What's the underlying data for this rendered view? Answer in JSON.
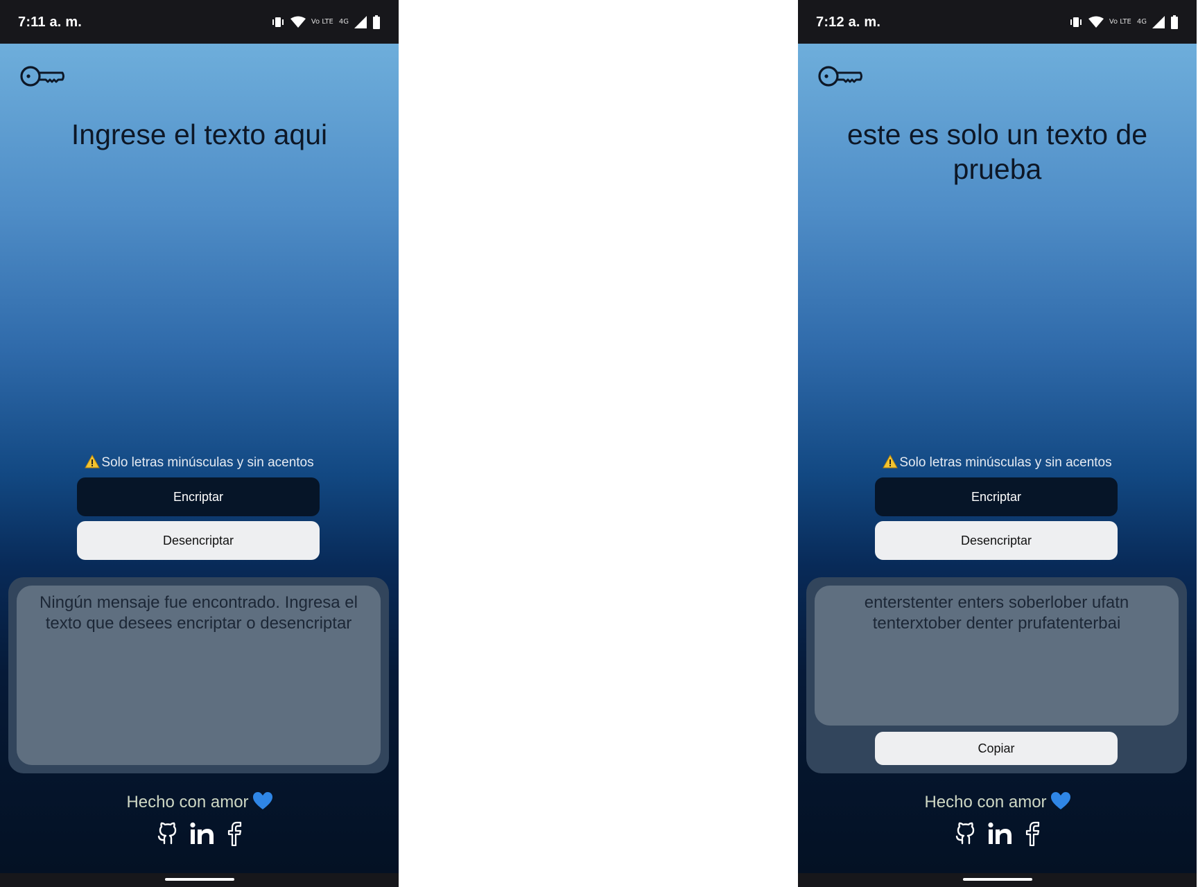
{
  "screens": [
    {
      "status_time": "7:11 a. m.",
      "network_label": "4G",
      "volte_label": "Vo LTE",
      "main_text": "Ingrese el texto aqui",
      "warning_text": "Solo letras minúsculas y sin acentos",
      "encrypt_label": "Encriptar",
      "decrypt_label": "Desencriptar",
      "output_text": "Ningún mensaje fue encontrado. Ingresa el texto que desees encriptar o desencriptar",
      "footer_text": "Hecho con amor"
    },
    {
      "status_time": "7:12 a. m.",
      "network_label": "4G",
      "volte_label": "Vo LTE",
      "main_text": "este es solo un texto de prueba",
      "warning_text": "Solo letras minúsculas y sin acentos",
      "encrypt_label": "Encriptar",
      "decrypt_label": "Desencriptar",
      "output_text": "enterstenter enters soberlober ufatn tenterxtober denter prufatenterbai",
      "copy_label": "Copiar",
      "footer_text": "Hecho con amor"
    }
  ],
  "icons": {
    "logo": "key-icon",
    "warning": "warning-icon",
    "heart": "blue-heart-icon",
    "social": [
      "github-icon",
      "linkedin-icon",
      "facebook-icon"
    ]
  },
  "colors": {
    "gradient_top": "#6eaedb",
    "gradient_bottom": "#041124",
    "encrypt_button": "#061528",
    "decrypt_button": "#eeeff1",
    "output_panel": "#32455c",
    "output_box": "#5f6f80",
    "heart": "#2f86e6",
    "warning": "#f4c430"
  }
}
